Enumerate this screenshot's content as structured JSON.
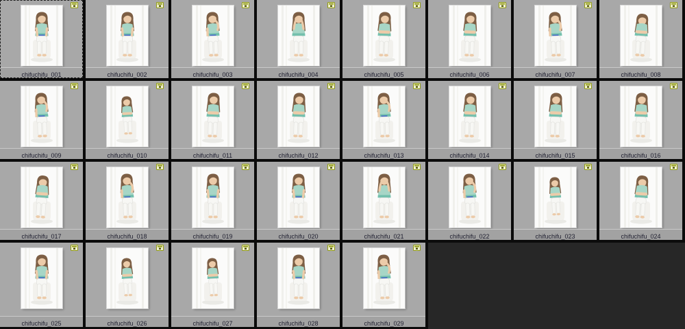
{
  "colors": {
    "page_bg": "#0b0b0b",
    "cell_bg": "#a8a8a8",
    "label_bar_bg": "#a2a2a2",
    "label_bar_bevel": "#c9c9c9",
    "label_text": "#1d1d2e",
    "empty_area": "#272727",
    "photo_bg": "#fbfbfa",
    "selection_dash": "#1a1a1a",
    "badge_olive": "#8f9a10",
    "badge_light": "#f0f0d0",
    "badge_dark": "#4f5408",
    "hair": "#7d5f45",
    "skin": "#eccba9",
    "shirt": "#a7d6c6",
    "shirt_dark": "#63b8a4",
    "pants": "#f7f7f4",
    "accent_blue": "#3a57c8"
  },
  "grid": {
    "columns": 8,
    "rows": 4,
    "badge_icon": "raw-file-badge",
    "thumbnails": [
      {
        "label": "chifuchifu_001",
        "selected": true,
        "pose": 0
      },
      {
        "label": "chifuchifu_002",
        "selected": false,
        "pose": 0
      },
      {
        "label": "chifuchifu_003",
        "selected": false,
        "pose": 1
      },
      {
        "label": "chifuchifu_004",
        "selected": false,
        "pose": 2
      },
      {
        "label": "chifuchifu_005",
        "selected": false,
        "pose": 3
      },
      {
        "label": "chifuchifu_006",
        "selected": false,
        "pose": 3
      },
      {
        "label": "chifuchifu_007",
        "selected": false,
        "pose": 1
      },
      {
        "label": "chifuchifu_008",
        "selected": false,
        "pose": 4
      },
      {
        "label": "chifuchifu_009",
        "selected": false,
        "pose": 1
      },
      {
        "label": "chifuchifu_010",
        "selected": false,
        "pose": 5
      },
      {
        "label": "chifuchifu_011",
        "selected": false,
        "pose": 3
      },
      {
        "label": "chifuchifu_012",
        "selected": false,
        "pose": 3
      },
      {
        "label": "chifuchifu_013",
        "selected": false,
        "pose": 1
      },
      {
        "label": "chifuchifu_014",
        "selected": false,
        "pose": 3
      },
      {
        "label": "chifuchifu_015",
        "selected": false,
        "pose": 3
      },
      {
        "label": "chifuchifu_016",
        "selected": false,
        "pose": 3
      },
      {
        "label": "chifuchifu_017",
        "selected": false,
        "pose": 4
      },
      {
        "label": "chifuchifu_018",
        "selected": false,
        "pose": 1
      },
      {
        "label": "chifuchifu_019",
        "selected": false,
        "pose": 0
      },
      {
        "label": "chifuchifu_020",
        "selected": false,
        "pose": 0
      },
      {
        "label": "chifuchifu_021",
        "selected": false,
        "pose": 2
      },
      {
        "label": "chifuchifu_022",
        "selected": false,
        "pose": 1
      },
      {
        "label": "chifuchifu_023",
        "selected": false,
        "pose": 5
      },
      {
        "label": "chifuchifu_024",
        "selected": false,
        "pose": 4
      },
      {
        "label": "chifuchifu_025",
        "selected": false,
        "pose": 0
      },
      {
        "label": "chifuchifu_026",
        "selected": false,
        "pose": 5
      },
      {
        "label": "chifuchifu_027",
        "selected": false,
        "pose": 5
      },
      {
        "label": "chifuchifu_028",
        "selected": false,
        "pose": 0
      },
      {
        "label": "chifuchifu_029",
        "selected": false,
        "pose": 1
      }
    ]
  }
}
